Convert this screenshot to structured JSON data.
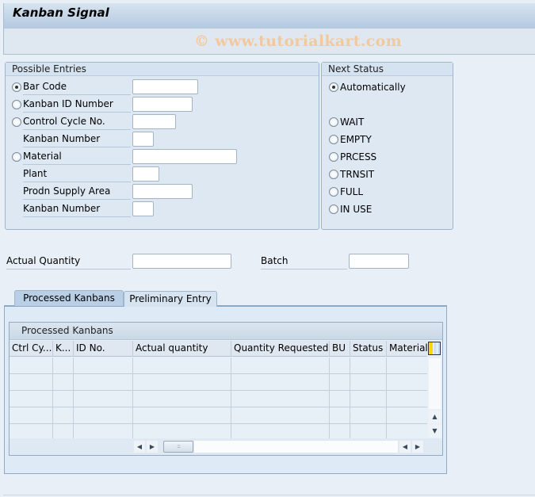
{
  "window": {
    "title": "Kanban Signal",
    "watermark": "© www.tutorialkart.com"
  },
  "possible_entries": {
    "header": "Possible Entries",
    "rows": [
      {
        "label": "Bar Code",
        "radio": true,
        "checked": true,
        "value": ""
      },
      {
        "label": "Kanban ID Number",
        "radio": true,
        "checked": false,
        "value": ""
      },
      {
        "label": "Control Cycle No.",
        "radio": true,
        "checked": false,
        "value": ""
      },
      {
        "label": "Kanban Number",
        "radio": false,
        "checked": false,
        "value": ""
      },
      {
        "label": "Material",
        "radio": true,
        "checked": false,
        "value": ""
      },
      {
        "label": "Plant",
        "radio": false,
        "checked": false,
        "value": ""
      },
      {
        "label": "Prodn Supply Area",
        "radio": false,
        "checked": false,
        "value": ""
      },
      {
        "label": "Kanban Number",
        "radio": false,
        "checked": false,
        "value": ""
      }
    ]
  },
  "next_status": {
    "header": "Next Status",
    "options": [
      {
        "label": "Automatically",
        "checked": true
      },
      {
        "label": "WAIT",
        "checked": false
      },
      {
        "label": "EMPTY",
        "checked": false
      },
      {
        "label": "PRCESS",
        "checked": false
      },
      {
        "label": "TRNSIT",
        "checked": false
      },
      {
        "label": "FULL",
        "checked": false
      },
      {
        "label": "IN USE",
        "checked": false
      }
    ]
  },
  "quantity": {
    "actual_quantity_label": "Actual Quantity",
    "actual_quantity_value": "",
    "batch_label": "Batch",
    "batch_value": ""
  },
  "tabs": [
    {
      "label": "Processed Kanbans",
      "active": true
    },
    {
      "label": "Preliminary Entry",
      "active": false
    }
  ],
  "table": {
    "caption": "Processed Kanbans",
    "columns": [
      "Ctrl Cy...",
      "K...",
      "ID No.",
      "Actual quantity",
      "Quantity Requested",
      "BU",
      "Status",
      "Material"
    ],
    "rows": [
      [
        "",
        "",
        "",
        "",
        "",
        "",
        "",
        ""
      ],
      [
        "",
        "",
        "",
        "",
        "",
        "",
        "",
        ""
      ],
      [
        "",
        "",
        "",
        "",
        "",
        "",
        "",
        ""
      ],
      [
        "",
        "",
        "",
        "",
        "",
        "",
        "",
        ""
      ],
      [
        "",
        "",
        "",
        "",
        "",
        "",
        "",
        ""
      ]
    ],
    "icons": {
      "column_settings": "column-settings-icon",
      "scroll_up": "▲",
      "scroll_down": "▼",
      "scroll_left": "◀",
      "scroll_right": "▶",
      "thumb_grip": ":::"
    }
  }
}
